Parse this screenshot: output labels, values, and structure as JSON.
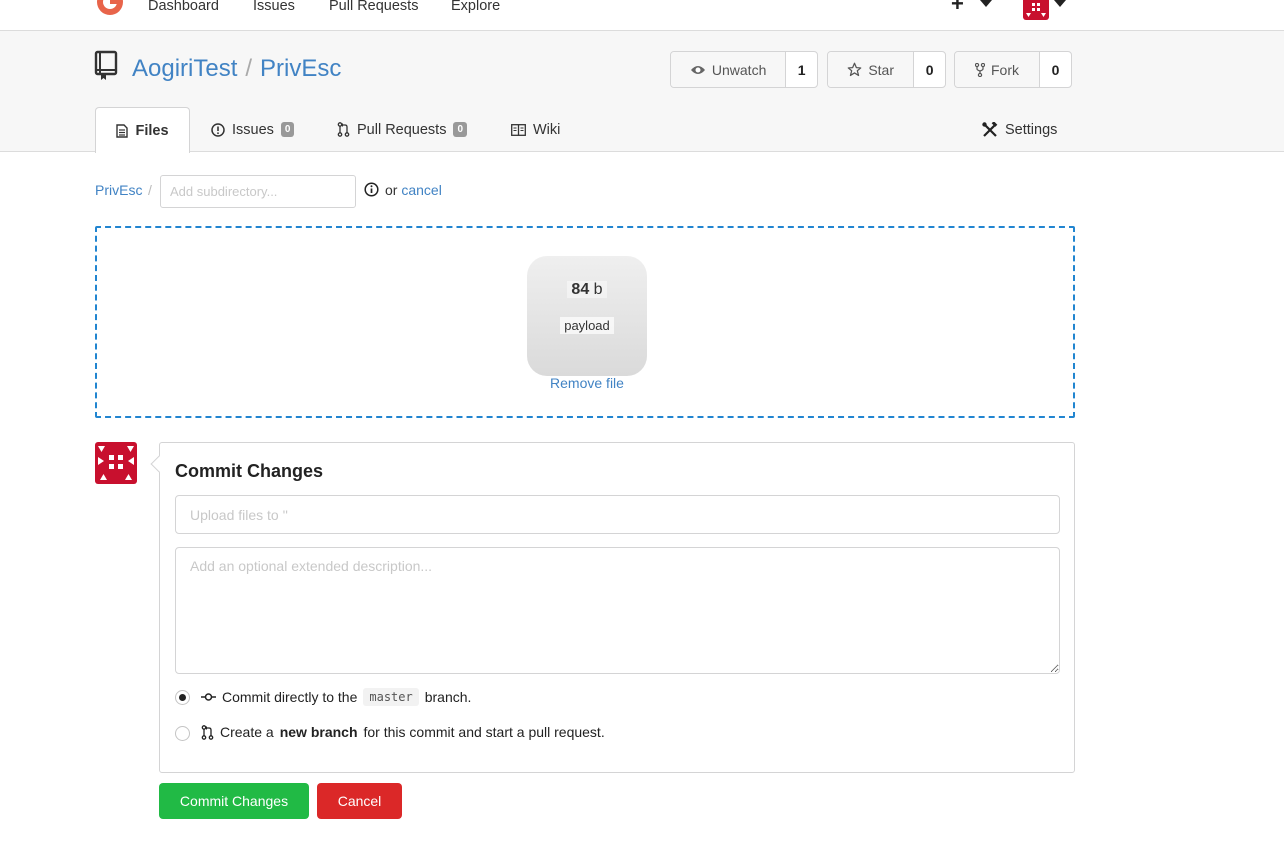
{
  "nav": {
    "links": [
      "Dashboard",
      "Issues",
      "Pull Requests",
      "Explore"
    ],
    "plus": "+"
  },
  "repo": {
    "owner": "AogiriTest",
    "separator": "/",
    "name": "PrivEsc",
    "unwatch": {
      "label": "Unwatch",
      "count": "1"
    },
    "star": {
      "label": "Star",
      "count": "0"
    },
    "fork": {
      "label": "Fork",
      "count": "0"
    }
  },
  "tabs": {
    "files": "Files",
    "issues": "Issues",
    "issues_count": "0",
    "pulls": "Pull Requests",
    "pulls_count": "0",
    "wiki": "Wiki",
    "settings": "Settings"
  },
  "breadcrumb": {
    "repo": "PrivEsc",
    "slash": "/",
    "subdir_placeholder": "Add subdirectory...",
    "or": "or",
    "cancel": "cancel"
  },
  "upload": {
    "size_value": "84",
    "size_unit": "b",
    "filename": "payload",
    "remove": "Remove file"
  },
  "commit": {
    "title": "Commit Changes",
    "summary_placeholder": "Upload files to ''",
    "description_placeholder": "Add an optional extended description...",
    "option1_prefix": "Commit directly to the",
    "branch": "master",
    "option1_suffix": "branch.",
    "option2_prefix": "Create a",
    "option2_bold": "new branch",
    "option2_suffix": "for this commit and start a pull request.",
    "submit": "Commit Changes",
    "cancel": "Cancel"
  },
  "colors": {
    "link": "#4183c4",
    "dropzone_border": "#2185d0",
    "commit_button": "#21ba45",
    "cancel_button": "#db2828",
    "avatar": "#c8102e"
  }
}
